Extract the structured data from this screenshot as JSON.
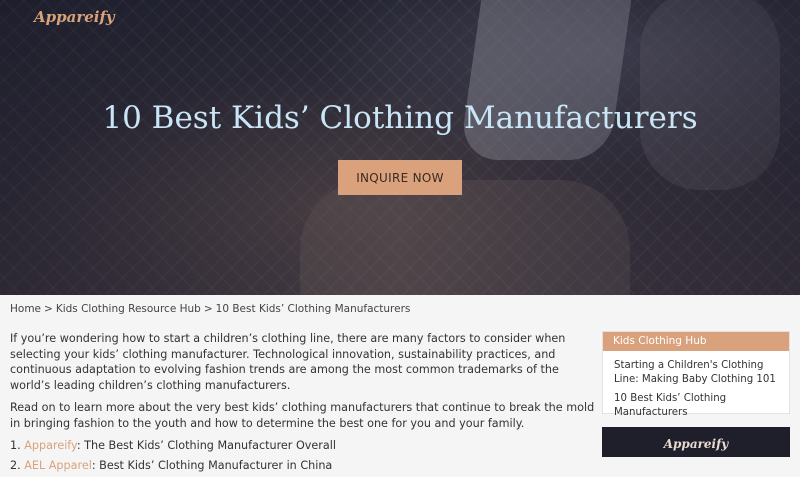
{
  "site": {
    "logo": "Appareify"
  },
  "hero": {
    "title": "10 Best Kids’ Clothing Manufacturers",
    "cta_label": "INQUIRE NOW"
  },
  "breadcrumb": {
    "items": [
      "Home",
      "Kids Clothing Resource Hub",
      "10 Best Kids’ Clothing Manufacturers"
    ],
    "separator": ">"
  },
  "content": {
    "paragraphs": [
      "If you’re wondering how to start a children’s clothing line, there are many factors to consider when selecting your kids’ clothing manufacturer. Technological innovation, sustainability practices, and continuous adaptation to evolving fashion trends are among the most common trademarks of the world’s leading children’s clothing manufacturers.",
      "Read on to learn more about the very best kids’ clothing manufacturers that continue to break the mold in bringing fashion to the youth and how to determine the best one for you and your family."
    ],
    "list": [
      {
        "num": "1.",
        "link": "Appareify",
        "text": ": The Best Kids’ Clothing Manufacturer Overall"
      },
      {
        "num": "2.",
        "link": "AEL Apparel",
        "text": ": Best Kids’ Clothing Manufacturer in China"
      }
    ]
  },
  "sidebar": {
    "widget_title": "Kids Clothing Hub",
    "links": [
      "Starting a Children's Clothing Line: Making Baby Clothing 101",
      "10 Best Kids’ Clothing Manufacturers"
    ],
    "promo_logo": "Appareify"
  },
  "colors": {
    "accent": "#d9a27d",
    "hero_title": "#c9e6f7",
    "promo_bg": "#1f1f2c"
  }
}
